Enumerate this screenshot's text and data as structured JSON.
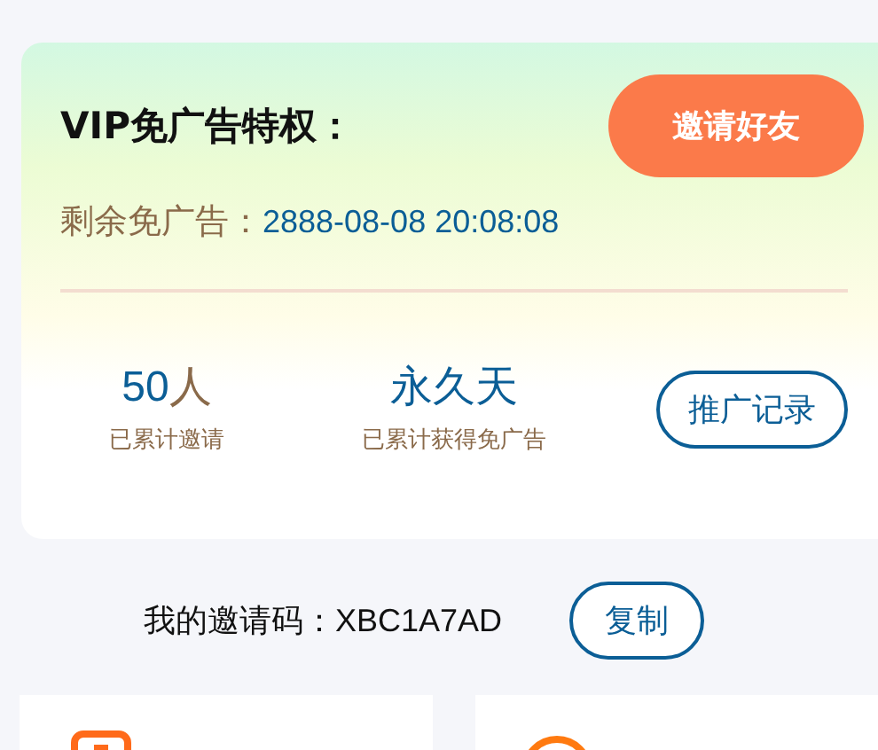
{
  "vip_card": {
    "title": "VIP免广告特权：",
    "invite_button": "邀请好友",
    "expiry_label": "剩余免广告：",
    "expiry_value": "2888-08-08 20:08:08",
    "stats": [
      {
        "value": "50",
        "unit": "人",
        "label": "已累计邀请"
      },
      {
        "value": "永久天",
        "label": "已累计获得免广告"
      }
    ],
    "records_button": "推广记录"
  },
  "invite_code": {
    "label": "我的邀请码：",
    "code": "XBC1A7AD",
    "copy_button": "复制"
  },
  "feature_cards": [
    {
      "kind": "square"
    },
    {
      "kind": "circle"
    }
  ]
}
